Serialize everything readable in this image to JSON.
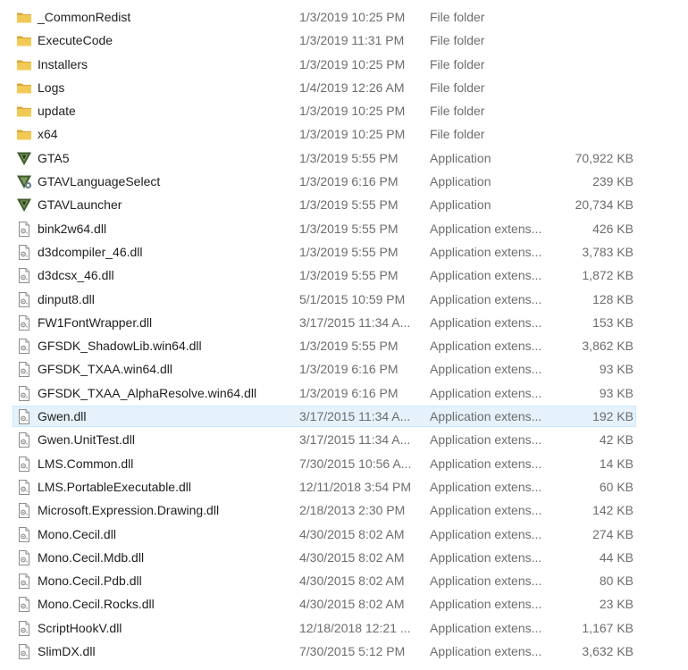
{
  "files": [
    {
      "name": "_CommonRedist",
      "date": "1/3/2019 10:25 PM",
      "type": "File folder",
      "size": "",
      "icon": "folder-icon"
    },
    {
      "name": "ExecuteCode",
      "date": "1/3/2019 11:31 PM",
      "type": "File folder",
      "size": "",
      "icon": "folder-icon"
    },
    {
      "name": "Installers",
      "date": "1/3/2019 10:25 PM",
      "type": "File folder",
      "size": "",
      "icon": "folder-icon"
    },
    {
      "name": "Logs",
      "date": "1/4/2019 12:26 AM",
      "type": "File folder",
      "size": "",
      "icon": "folder-icon"
    },
    {
      "name": "update",
      "date": "1/3/2019 10:25 PM",
      "type": "File folder",
      "size": "",
      "icon": "folder-icon"
    },
    {
      "name": "x64",
      "date": "1/3/2019 10:25 PM",
      "type": "File folder",
      "size": "",
      "icon": "folder-icon"
    },
    {
      "name": "GTA5",
      "date": "1/3/2019 5:55 PM",
      "type": "Application",
      "size": "70,922 KB",
      "icon": "gtav-app-icon"
    },
    {
      "name": "GTAVLanguageSelect",
      "date": "1/3/2019 6:16 PM",
      "type": "Application",
      "size": "239 KB",
      "icon": "gtav-settings-app-icon"
    },
    {
      "name": "GTAVLauncher",
      "date": "1/3/2019 5:55 PM",
      "type": "Application",
      "size": "20,734 KB",
      "icon": "gtav-app-icon"
    },
    {
      "name": "bink2w64.dll",
      "date": "1/3/2019 5:55 PM",
      "type": "Application extens...",
      "size": "426 KB",
      "icon": "dll-file-icon"
    },
    {
      "name": "d3dcompiler_46.dll",
      "date": "1/3/2019 5:55 PM",
      "type": "Application extens...",
      "size": "3,783 KB",
      "icon": "dll-file-icon"
    },
    {
      "name": "d3dcsx_46.dll",
      "date": "1/3/2019 5:55 PM",
      "type": "Application extens...",
      "size": "1,872 KB",
      "icon": "dll-file-icon"
    },
    {
      "name": "dinput8.dll",
      "date": "5/1/2015 10:59 PM",
      "type": "Application extens...",
      "size": "128 KB",
      "icon": "dll-file-icon"
    },
    {
      "name": "FW1FontWrapper.dll",
      "date": "3/17/2015 11:34 A...",
      "type": "Application extens...",
      "size": "153 KB",
      "icon": "dll-file-icon"
    },
    {
      "name": "GFSDK_ShadowLib.win64.dll",
      "date": "1/3/2019 5:55 PM",
      "type": "Application extens...",
      "size": "3,862 KB",
      "icon": "dll-file-icon"
    },
    {
      "name": "GFSDK_TXAA.win64.dll",
      "date": "1/3/2019 6:16 PM",
      "type": "Application extens...",
      "size": "93 KB",
      "icon": "dll-file-icon"
    },
    {
      "name": "GFSDK_TXAA_AlphaResolve.win64.dll",
      "date": "1/3/2019 6:16 PM",
      "type": "Application extens...",
      "size": "93 KB",
      "icon": "dll-file-icon"
    },
    {
      "name": "Gwen.dll",
      "date": "3/17/2015 11:34 A...",
      "type": "Application extens...",
      "size": "192 KB",
      "icon": "dll-file-icon",
      "selected": true
    },
    {
      "name": "Gwen.UnitTest.dll",
      "date": "3/17/2015 11:34 A...",
      "type": "Application extens...",
      "size": "42 KB",
      "icon": "dll-file-icon"
    },
    {
      "name": "LMS.Common.dll",
      "date": "7/30/2015 10:56 A...",
      "type": "Application extens...",
      "size": "14 KB",
      "icon": "dll-file-icon"
    },
    {
      "name": "LMS.PortableExecutable.dll",
      "date": "12/11/2018 3:54 PM",
      "type": "Application extens...",
      "size": "60 KB",
      "icon": "dll-file-icon"
    },
    {
      "name": "Microsoft.Expression.Drawing.dll",
      "date": "2/18/2013 2:30 PM",
      "type": "Application extens...",
      "size": "142 KB",
      "icon": "dll-file-icon"
    },
    {
      "name": "Mono.Cecil.dll",
      "date": "4/30/2015 8:02 AM",
      "type": "Application extens...",
      "size": "274 KB",
      "icon": "dll-file-icon"
    },
    {
      "name": "Mono.Cecil.Mdb.dll",
      "date": "4/30/2015 8:02 AM",
      "type": "Application extens...",
      "size": "44 KB",
      "icon": "dll-file-icon"
    },
    {
      "name": "Mono.Cecil.Pdb.dll",
      "date": "4/30/2015 8:02 AM",
      "type": "Application extens...",
      "size": "80 KB",
      "icon": "dll-file-icon"
    },
    {
      "name": "Mono.Cecil.Rocks.dll",
      "date": "4/30/2015 8:02 AM",
      "type": "Application extens...",
      "size": "23 KB",
      "icon": "dll-file-icon"
    },
    {
      "name": "ScriptHookV.dll",
      "date": "12/18/2018 12:21 ...",
      "type": "Application extens...",
      "size": "1,167 KB",
      "icon": "dll-file-icon"
    },
    {
      "name": "SlimDX.dll",
      "date": "7/30/2015 5:12 PM",
      "type": "Application extens...",
      "size": "3,632 KB",
      "icon": "dll-file-icon"
    }
  ],
  "colors": {
    "selection_bg": "#e5f1fb",
    "selection_border": "#cce8ff",
    "folder": "#e8b94a",
    "gtav_icon": "#3e5b2c",
    "secondary_text": "#6d6d6d"
  }
}
